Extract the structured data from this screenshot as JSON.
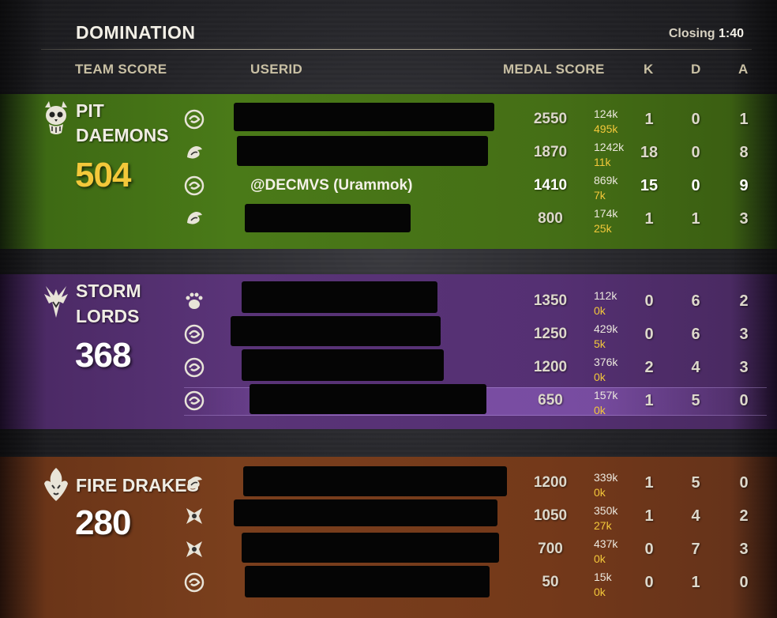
{
  "header": {
    "title": "DOMINATION",
    "closing_label": "Closing",
    "closing_time": "1:40"
  },
  "columns": {
    "team_score": "TEAM SCORE",
    "userid": "USERID",
    "medal_score": "MEDAL SCORE",
    "k": "K",
    "d": "D",
    "a": "A"
  },
  "colors": {
    "pit_daemons": "#4a7a18",
    "storm_lords": "#5a3478",
    "fire_drakes": "#7a3f1d",
    "accent_gold": "#f3c83a"
  },
  "teams": [
    {
      "name_line1": "PIT",
      "name_line2": "DAEMONS",
      "score": "504",
      "icon": "pit-daemons-skull-icon",
      "players": [
        {
          "class_icon": "warden-circle-icon",
          "userid": "",
          "medal": "2550",
          "sub1": "124k",
          "sub2": "495k",
          "k": "1",
          "d": "0",
          "a": "1"
        },
        {
          "class_icon": "dragonknight-icon",
          "userid": "",
          "medal": "1870",
          "sub1": "1242k",
          "sub2": "11k",
          "k": "18",
          "d": "0",
          "a": "8"
        },
        {
          "class_icon": "warden-circle-icon",
          "userid": "@DECMVS (Urammok)",
          "medal": "1410",
          "sub1": "869k",
          "sub2": "7k",
          "k": "15",
          "d": "0",
          "a": "9"
        },
        {
          "class_icon": "dragonknight-icon",
          "userid": "",
          "medal": "800",
          "sub1": "174k",
          "sub2": "25k",
          "k": "1",
          "d": "1",
          "a": "3"
        }
      ]
    },
    {
      "name_line1": "STORM",
      "name_line2": "LORDS",
      "score": "368",
      "icon": "storm-lords-icon",
      "players": [
        {
          "class_icon": "bear-paw-icon",
          "userid": "",
          "medal": "1350",
          "sub1": "112k",
          "sub2": "0k",
          "k": "0",
          "d": "6",
          "a": "2"
        },
        {
          "class_icon": "warden-circle-icon",
          "userid": "",
          "medal": "1250",
          "sub1": "429k",
          "sub2": "5k",
          "k": "0",
          "d": "6",
          "a": "3"
        },
        {
          "class_icon": "warden-circle-icon",
          "userid": "",
          "medal": "1200",
          "sub1": "376k",
          "sub2": "0k",
          "k": "2",
          "d": "4",
          "a": "3"
        },
        {
          "class_icon": "warden-circle-icon",
          "userid": "",
          "medal": "650",
          "sub1": "157k",
          "sub2": "0k",
          "k": "1",
          "d": "5",
          "a": "0"
        }
      ]
    },
    {
      "name_line1": "FIRE DRAKES",
      "name_line2": "",
      "score": "280",
      "icon": "fire-drakes-icon",
      "players": [
        {
          "class_icon": "dragonknight-icon",
          "userid": "",
          "medal": "1200",
          "sub1": "339k",
          "sub2": "0k",
          "k": "1",
          "d": "5",
          "a": "0"
        },
        {
          "class_icon": "nightblade-icon",
          "userid": "",
          "medal": "1050",
          "sub1": "350k",
          "sub2": "27k",
          "k": "1",
          "d": "4",
          "a": "2"
        },
        {
          "class_icon": "nightblade-icon",
          "userid": "",
          "medal": "700",
          "sub1": "437k",
          "sub2": "0k",
          "k": "0",
          "d": "7",
          "a": "3"
        },
        {
          "class_icon": "warden-circle-icon",
          "userid": "",
          "medal": "50",
          "sub1": "15k",
          "sub2": "0k",
          "k": "0",
          "d": "1",
          "a": "0"
        }
      ]
    }
  ]
}
